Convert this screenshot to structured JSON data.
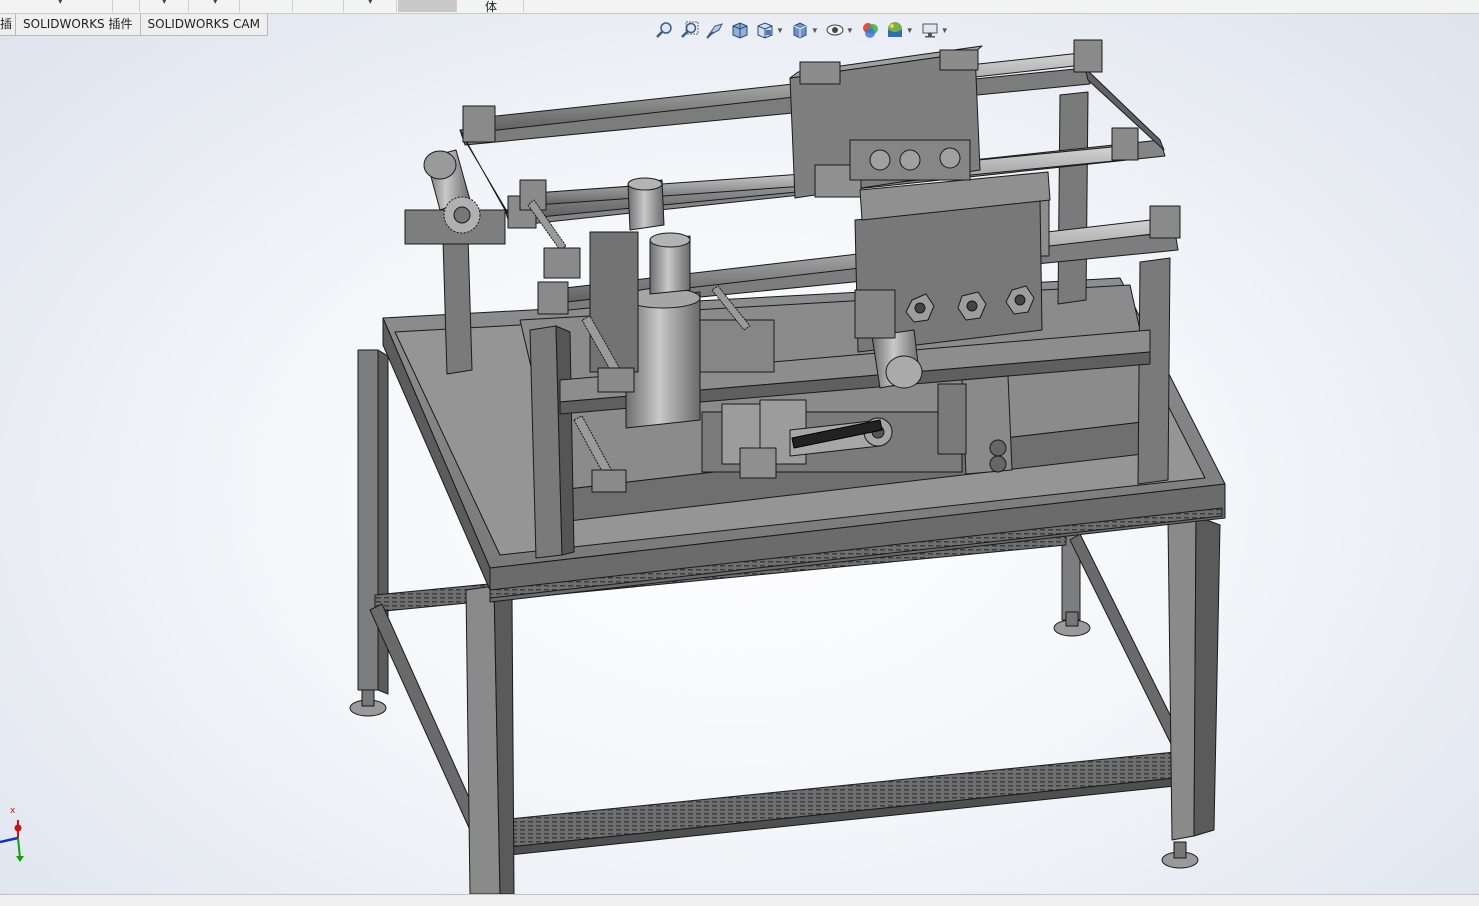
{
  "tabs": [
    {
      "label": "插",
      "truncated": true
    },
    {
      "label": "SOLIDWORKS 插件"
    },
    {
      "label": "SOLIDWORKS CAM"
    }
  ],
  "ribbon": {
    "active_segment_label": "体"
  },
  "heads_up_toolbar": [
    {
      "icon": "zoom-to-fit-icon"
    },
    {
      "icon": "zoom-to-area-icon"
    },
    {
      "icon": "previous-view-icon"
    },
    {
      "icon": "section-view-icon"
    },
    {
      "icon": "view-orientation-icon",
      "dropdown": true
    },
    {
      "icon": "display-style-icon",
      "dropdown": true
    },
    {
      "icon": "hide-show-items-icon",
      "dropdown": true
    },
    {
      "icon": "edit-appearance-icon"
    },
    {
      "icon": "apply-scene-icon",
      "dropdown": true
    },
    {
      "icon": "view-settings-icon",
      "dropdown": true
    }
  ],
  "triad": {
    "x_label": "x"
  },
  "colors": {
    "accent_red": "#d11111",
    "accent_blue": "#1530c8",
    "accent_green": "#14a014",
    "model_gray": "#8c8c8c"
  }
}
